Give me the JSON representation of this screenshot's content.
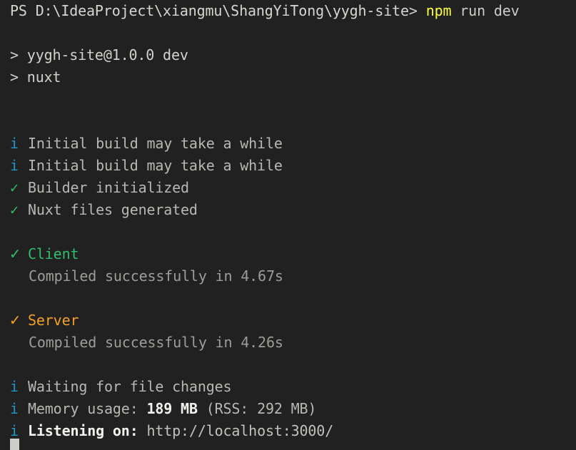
{
  "terminal": {
    "shell": "PowerShell",
    "background_color": "#212121",
    "foreground_color": "#ccccc6",
    "cursor_color": "#cdcdc9",
    "accent_colors": {
      "info": "#2196c8",
      "success": "#2fbe6e",
      "warning": "#f2a026",
      "command": "#ffff3f",
      "bright": "#f2f2ee"
    },
    "prompt": {
      "shell_prefix": "PS ",
      "working_directory": "D:\\IdeaProject\\xiangmu\\ShangYiTong\\yygh-site",
      "prompt_symbol": "> ",
      "command": "npm",
      "command_args": " run dev"
    },
    "npm_script_lines": [
      {
        "arrow": "> ",
        "text": "yygh-site@1.0.0 dev"
      },
      {
        "arrow": "> ",
        "text": "nuxt"
      }
    ],
    "build_log": [
      {
        "marker": "i",
        "marker_type": "info",
        "text": "Initial build may take a while"
      },
      {
        "marker": "i",
        "marker_type": "info",
        "text": "Initial build may take a while"
      },
      {
        "marker": "✓",
        "marker_type": "ok-green",
        "text": "Builder initialized"
      },
      {
        "marker": "✓",
        "marker_type": "ok-green",
        "text": "Nuxt files generated"
      }
    ],
    "bundles": [
      {
        "marker": "✓",
        "marker_type": "ok-green",
        "name": "Client",
        "name_color": "#2fbe6e",
        "status": "Compiled successfully in 4.67s"
      },
      {
        "marker": "✓",
        "marker_type": "ok-orange",
        "name": "Server",
        "name_color": "#f2a026",
        "status": "Compiled successfully in 4.26s"
      }
    ],
    "status_log": {
      "waiting": {
        "marker": "i",
        "text": "Waiting for file changes"
      },
      "memory": {
        "marker": "i",
        "label": "Memory usage: ",
        "value": "189 MB",
        "rss": " (RSS: 292 MB)"
      },
      "listening": {
        "marker": "i",
        "label": "Listening on: ",
        "url": "http://localhost:3000/"
      }
    }
  }
}
